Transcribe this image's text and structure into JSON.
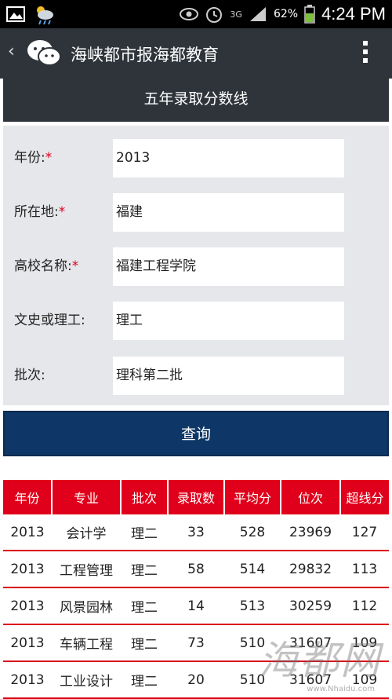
{
  "status_bar": {
    "time": "4:24 PM",
    "battery": "62%",
    "network": "3G",
    "icons": [
      "gallery-icon",
      "weather-icon",
      "eye-icon",
      "alarm-icon",
      "signal-icon",
      "battery-icon"
    ]
  },
  "action_bar": {
    "title": "海峡都市报海都教育",
    "icons": [
      "chevron-left-icon",
      "wechat-icon",
      "overflow-menu-icon"
    ]
  },
  "page": {
    "title": "五年录取分数线"
  },
  "form": {
    "year": {
      "label": "年份:",
      "required": "*",
      "value": "2013"
    },
    "location": {
      "label": "所在地:",
      "required": "*",
      "value": "福建"
    },
    "school": {
      "label": "高校名称:",
      "required": "*",
      "value": "福建工程学院"
    },
    "track": {
      "label": "文史或理工:",
      "value": "理工"
    },
    "batch": {
      "label": "批次:",
      "value": "理科第二批"
    },
    "submit_label": "查询"
  },
  "table": {
    "headers": [
      "年份",
      "专业",
      "批次",
      "录取数",
      "平均分",
      "位次",
      "超线分"
    ],
    "rows": [
      [
        "2013",
        "会计学",
        "理二",
        "33",
        "528",
        "23969",
        "127"
      ],
      [
        "2013",
        "工程管理",
        "理二",
        "58",
        "514",
        "29832",
        "113"
      ],
      [
        "2013",
        "风景园林",
        "理二",
        "14",
        "513",
        "30259",
        "112"
      ],
      [
        "2013",
        "车辆工程",
        "理二",
        "73",
        "510",
        "31607",
        "109"
      ],
      [
        "2013",
        "工业设计",
        "理二",
        "20",
        "510",
        "31607",
        "109"
      ]
    ]
  },
  "watermark": {
    "text": "海都网",
    "url": "www.Nhaidu.com"
  },
  "colors": {
    "header_bg": "#2f343b",
    "table_header": "#e0001b",
    "button": "#0e3767",
    "form_bg": "#e6e7ea"
  }
}
